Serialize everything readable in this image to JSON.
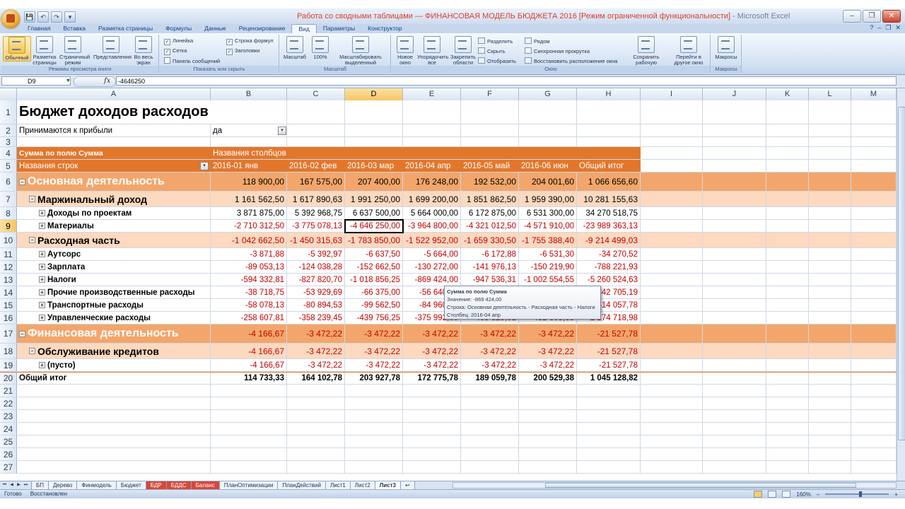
{
  "window": {
    "title_red": "Работа со сводными таблицами — ФИНАНСОВАЯ МОДЕЛЬ БЮДЖЕТА 2016 [Режим ограниченной функциональности]",
    "title_app": " - Microsoft Excel",
    "office_button": "Office",
    "qat": [
      "💾",
      "↶",
      "↷",
      "▾"
    ],
    "minimize": "–",
    "maximize": "❐",
    "close": "✕"
  },
  "ribbon_tabs": [
    {
      "label": "Главная"
    },
    {
      "label": "Вставка"
    },
    {
      "label": "Разметка страницы"
    },
    {
      "label": "Формулы"
    },
    {
      "label": "Данные"
    },
    {
      "label": "Рецензирование"
    },
    {
      "label": "Вид"
    },
    {
      "label": "Параметры"
    },
    {
      "label": "Конструктор"
    }
  ],
  "ribbon_help": [
    "?",
    "–",
    "❐",
    "✕"
  ],
  "ribbon": {
    "group_views": {
      "label": "Режимы просмотра книги",
      "normal": "Обычный",
      "page_layout": "Разметка страницы",
      "page_break": "Страничный режим",
      "custom_views": "Представления",
      "fullscreen": "Во весь экран"
    },
    "group_show": {
      "label": "Показать или скрыть",
      "ruler": "Линейка",
      "grid": "Сетка",
      "msgbar": "Панель сообщений",
      "formula_bar": "Строка формул",
      "headings": "Заголовки"
    },
    "group_zoom": {
      "label": "Масштаб",
      "zoom": "Масштаб",
      "zoom100": "100%",
      "zoom_sel": "Масштабировать выделенный фрагмент"
    },
    "group_window": {
      "label": "Окно",
      "new_window": "Новое окно",
      "arrange_all": "Упорядочить все",
      "freeze": "Закрепить области",
      "split": "Разделить",
      "hide": "Скрыть",
      "unhide": "Отобразить",
      "side_by_side": "Рядом",
      "sync_scroll": "Синхронная прокрутка",
      "reset_pos": "Восстановить расположение окна",
      "save_ws": "Сохранить рабочую область",
      "switch": "Перейти в другое окно"
    },
    "group_macros": {
      "label": "Макросы",
      "macros": "Макросы"
    }
  },
  "formula_bar": {
    "name_box": "D9",
    "fx": "fx",
    "formula": "-4646250"
  },
  "columns": [
    {
      "name": "A",
      "selected": false
    },
    {
      "name": "B",
      "selected": false
    },
    {
      "name": "C",
      "selected": false
    },
    {
      "name": "D",
      "selected": true
    },
    {
      "name": "E",
      "selected": false
    },
    {
      "name": "F",
      "selected": false
    },
    {
      "name": "G",
      "selected": false
    },
    {
      "name": "H",
      "selected": false
    },
    {
      "name": "I",
      "selected": false
    },
    {
      "name": "J",
      "selected": false
    },
    {
      "name": "K",
      "selected": false
    },
    {
      "name": "L",
      "selected": false
    },
    {
      "name": "M",
      "selected": false
    }
  ],
  "sheet": {
    "title": "Бюджет доходов расходов",
    "filter_label": "Принимаются к прибыли",
    "filter_value": "да",
    "values_caption": "Сумма по полю Сумма",
    "col_labels": "Названия столбцов",
    "row_labels": "Названия строк",
    "months": [
      "2016-01 янв",
      "2016-02 фев",
      "2016-03 мар",
      "2016-04 апр",
      "2016-05 май",
      "2016-06 июн",
      "Общий итог"
    ],
    "rows": [
      {
        "num": "6",
        "style": "section",
        "toggle": "⊟",
        "indent": 0,
        "label": "Основная деятельность",
        "neg": false,
        "values": [
          "118 900,00",
          "167 575,00",
          "207 400,00",
          "176 248,00",
          "192 532,00",
          "204 001,60",
          "1 066 656,60"
        ]
      },
      {
        "num": "7",
        "style": "sub",
        "toggle": "⊟",
        "indent": 1,
        "label": "Маржинальный доход",
        "neg": false,
        "values": [
          "1 161 562,50",
          "1 617 890,63",
          "1 991 250,00",
          "1 699 200,00",
          "1 851 862,50",
          "1 959 390,00",
          "10 281 155,63"
        ]
      },
      {
        "num": "8",
        "style": "item",
        "toggle": "⊞",
        "indent": 2,
        "label": "Доходы по проектам",
        "neg": false,
        "values": [
          "3 871 875,00",
          "5 392 968,75",
          "6 637 500,00",
          "5 664 000,00",
          "6 172 875,00",
          "6 531 300,00",
          "34 270 518,75"
        ]
      },
      {
        "num": "9",
        "style": "item",
        "toggle": "⊞",
        "indent": 2,
        "label": "Материалы",
        "neg": true,
        "values": [
          "-2 710 312,50",
          "-3 775 078,13",
          "-4 646 250,00",
          "-3 964 800,00",
          "-4 321 012,50",
          "-4 571 910,00",
          "-23 989 363,13"
        ]
      },
      {
        "num": "10",
        "style": "sub",
        "toggle": "⊟",
        "indent": 1,
        "label": "Расходная часть",
        "neg": true,
        "values": [
          "-1 042 662,50",
          "-1 450 315,63",
          "-1 783 850,00",
          "-1 522 952,00",
          "-1 659 330,50",
          "-1 755 388,40",
          "-9 214 499,03"
        ]
      },
      {
        "num": "11",
        "style": "item",
        "toggle": "⊞",
        "indent": 2,
        "label": "Аутсорс",
        "neg": true,
        "values": [
          "-3 871,88",
          "-5 392,97",
          "-6 637,50",
          "-5 664,00",
          "-6 172,88",
          "-6 531,30",
          "-34 270,52"
        ]
      },
      {
        "num": "12",
        "style": "item",
        "toggle": "⊞",
        "indent": 2,
        "label": "Зарплата",
        "neg": true,
        "values": [
          "-89 053,13",
          "-124 038,28",
          "-152 662,50",
          "-130 272,00",
          "-141 976,13",
          "-150 219,90",
          "-788 221,93"
        ]
      },
      {
        "num": "13",
        "style": "item",
        "toggle": "⊞",
        "indent": 2,
        "label": "Налоги",
        "neg": true,
        "values": [
          "-594 332,81",
          "-827 820,70",
          "-1 018 856,25",
          "-869 424,00",
          "-947 536,31",
          "-1 002 554,55",
          "-5 260 524,63"
        ]
      },
      {
        "num": "14",
        "style": "item",
        "toggle": "⊞",
        "indent": 2,
        "label": "Прочие производственные расходы",
        "neg": true,
        "values": [
          "-38 718,75",
          "-53 929,69",
          "-66 375,00",
          "-56 640,00",
          "",
          "",
          "-342 705,19"
        ]
      },
      {
        "num": "15",
        "style": "item",
        "toggle": "⊞",
        "indent": 2,
        "label": "Транспортные расходы",
        "neg": true,
        "values": [
          "-58 078,13",
          "-80 894,53",
          "-99 562,50",
          "-84 960,00",
          "",
          "",
          "-514 057,78"
        ]
      },
      {
        "num": "16",
        "style": "item",
        "toggle": "⊞",
        "indent": 2,
        "label": "Управленческие расходы",
        "neg": true,
        "values": [
          "-258 607,81",
          "-358 239,45",
          "-439 756,25",
          "-375 992,00",
          "-409 329,91",
          "-432 605,85",
          "-2 274 718,98"
        ]
      },
      {
        "num": "17",
        "style": "section",
        "toggle": "⊟",
        "indent": 0,
        "label": "Финансовая деятельность",
        "neg": true,
        "values": [
          "-4 166,67",
          "-3 472,22",
          "-3 472,22",
          "-3 472,22",
          "-3 472,22",
          "-3 472,22",
          "-21 527,78"
        ]
      },
      {
        "num": "18",
        "style": "sub",
        "toggle": "⊟",
        "indent": 1,
        "label": "Обслуживание кредитов",
        "neg": true,
        "values": [
          "-4 166,67",
          "-3 472,22",
          "-3 472,22",
          "-3 472,22",
          "-3 472,22",
          "-3 472,22",
          "-21 527,78"
        ]
      },
      {
        "num": "19",
        "style": "item",
        "toggle": "⊞",
        "indent": 2,
        "label": "(пусто)",
        "neg": true,
        "values": [
          "-4 166,67",
          "-3 472,22",
          "-3 472,22",
          "-3 472,22",
          "-3 472,22",
          "-3 472,22",
          "-21 527,78"
        ]
      },
      {
        "num": "20",
        "style": "total",
        "toggle": "",
        "indent": 0,
        "label": "Общий итог",
        "neg": false,
        "values": [
          "114 733,33",
          "164 102,78",
          "203 927,78",
          "172 775,78",
          "189 059,78",
          "200 529,38",
          "1 045 128,82"
        ]
      }
    ],
    "empty_rows": [
      "21",
      "22",
      "23",
      "24",
      "25",
      "26",
      "27"
    ]
  },
  "tooltip": {
    "line1": "Сумма по полю Сумма",
    "line2": "Значение: -869 424,00",
    "line3": "Строка: Основная деятельность - Расходная часть - Налоги",
    "line4": "Столбец: 2016-04 апр"
  },
  "sheet_tabs": [
    {
      "label": "БП",
      "colored": false,
      "active": false
    },
    {
      "label": "Дерево",
      "colored": false,
      "active": false
    },
    {
      "label": "Финмодель",
      "colored": false,
      "active": false
    },
    {
      "label": "Бюджет",
      "colored": false,
      "active": false
    },
    {
      "label": "БДР",
      "colored": true,
      "active": false
    },
    {
      "label": "БДДС",
      "colored": true,
      "active": false
    },
    {
      "label": "Баланс",
      "colored": true,
      "active": false
    },
    {
      "label": "ПланОптимизации",
      "colored": false,
      "active": false
    },
    {
      "label": "ПланДействий",
      "colored": false,
      "active": false
    },
    {
      "label": "Лист1",
      "colored": false,
      "active": false
    },
    {
      "label": "Лист2",
      "colored": false,
      "active": false
    },
    {
      "label": "Лист3",
      "colored": false,
      "active": true
    },
    {
      "label": "↩",
      "colored": false,
      "active": false
    }
  ],
  "status": {
    "ready": "Готово",
    "restored": "Восстановлен",
    "zoom": "160%",
    "zoom_minus": "–",
    "zoom_plus": "+"
  }
}
